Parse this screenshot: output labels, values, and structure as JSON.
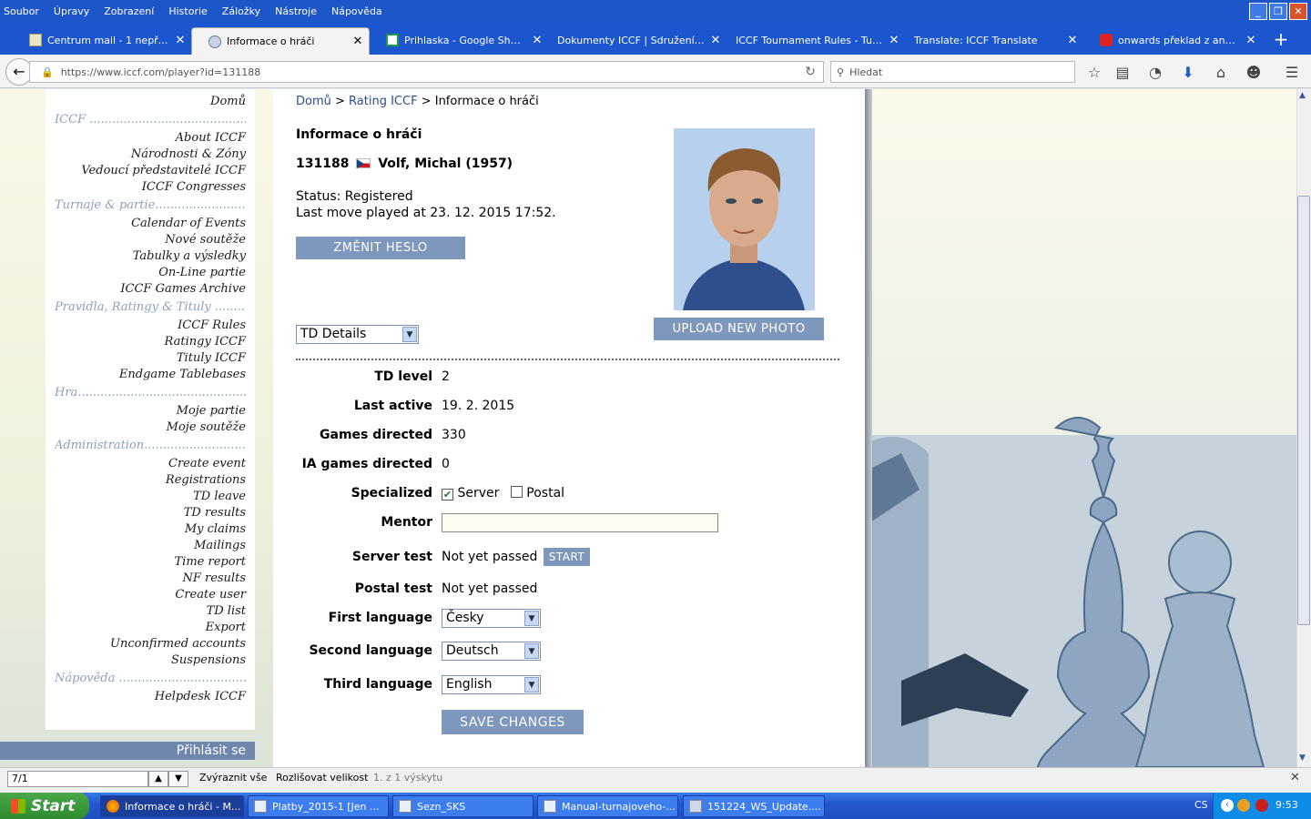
{
  "menu": [
    "Soubor",
    "Úpravy",
    "Zobrazení",
    "Historie",
    "Záložky",
    "Nástroje",
    "Nápověda"
  ],
  "tabs": [
    {
      "label": "Centrum mail - 1 nepřečte..."
    },
    {
      "label": "Informace o hráči"
    },
    {
      "label": "Prihlaska - Google Sheets"
    },
    {
      "label": "Dokumenty ICCF | Sdružení kor..."
    },
    {
      "label": "ICCF Tournament Rules - Turn..."
    },
    {
      "label": "Translate: ICCF Translate"
    },
    {
      "label": "onwards překlad z angličtin..."
    }
  ],
  "url": "https://www.iccf.com/player?id=131188",
  "search_placeholder": "Hledat",
  "sidebar": {
    "home": "Domů",
    "sections": [
      {
        "title": "ICCF",
        "items": [
          "About ICCF",
          "Národnosti & Zóny",
          "Vedoucí představitelé ICCF",
          "ICCF Congresses"
        ]
      },
      {
        "title": "Turnaje & partie",
        "items": [
          "Calendar of Events",
          "Nové soutěže",
          "Tabulky a výsledky",
          "On-Line partie",
          "ICCF Games Archive"
        ]
      },
      {
        "title": "Pravidla, Ratingy & Tituly",
        "items": [
          "ICCF Rules",
          "Ratingy ICCF",
          "Tituly ICCF",
          "Endgame Tablebases"
        ]
      },
      {
        "title": "Hra",
        "items": [
          "Moje partie",
          "Moje soutěže"
        ]
      },
      {
        "title": "Administration",
        "items": [
          "Create event",
          "Registrations",
          "TD leave",
          "TD results",
          "My claims",
          "Mailings",
          "Time report",
          "NF results",
          "Create user",
          "TD list",
          "Export",
          "Unconfirmed accounts",
          "Suspensions"
        ]
      },
      {
        "title": "Nápověda",
        "items": [
          "Helpdesk ICCF"
        ]
      }
    ],
    "login": "Přihlásit se"
  },
  "breadcrumb": [
    "Domů",
    "Rating ICCF",
    "Informace o hráči"
  ],
  "player": {
    "heading": "Informace o hráči",
    "id": "131188",
    "name": "Volf, Michal (1957)",
    "status": "Status: Registered",
    "last_move": "Last move played at 23. 12. 2015 17:52."
  },
  "buttons": {
    "change_password": "ZMĚNIT HESLO",
    "upload_photo": "UPLOAD NEW PHOTO",
    "start": "START",
    "save": "SAVE CHANGES"
  },
  "details_select": "TD Details",
  "td": {
    "level_label": "TD level",
    "level": "2",
    "last_active_label": "Last active",
    "last_active": "19. 2. 2015",
    "games_label": "Games directed",
    "games": "330",
    "ia_label": "IA games directed",
    "ia": "0",
    "specialized_label": "Specialized",
    "server": "Server",
    "postal": "Postal",
    "server_checked": true,
    "postal_checked": false,
    "mentor_label": "Mentor",
    "mentor": "",
    "server_test_label": "Server test",
    "server_test": "Not yet passed",
    "postal_test_label": "Postal test",
    "postal_test": "Not yet passed",
    "lang1_label": "First language",
    "lang1": "Česky",
    "lang2_label": "Second language",
    "lang2": "Deutsch",
    "lang3_label": "Third language",
    "lang3": "English"
  },
  "findbar": {
    "query": "7/1",
    "highlight": "Zvýraznit vše",
    "case": "Rozlišovat velikost",
    "result": "1. z 1 výskytu"
  },
  "taskbar": {
    "start": "Start",
    "tasks": [
      "Informace o hráči - M...",
      "Platby_2015-1  [Jen ...",
      "Sezn_SKS",
      "Manual-turnajoveho-...",
      "151224_WS_Update...."
    ],
    "lang": "CS",
    "time": "9:53"
  },
  "colors": {
    "accent": "#7e97bc",
    "tabbar": "#1b56cf",
    "taskbar": "#2458d0"
  }
}
